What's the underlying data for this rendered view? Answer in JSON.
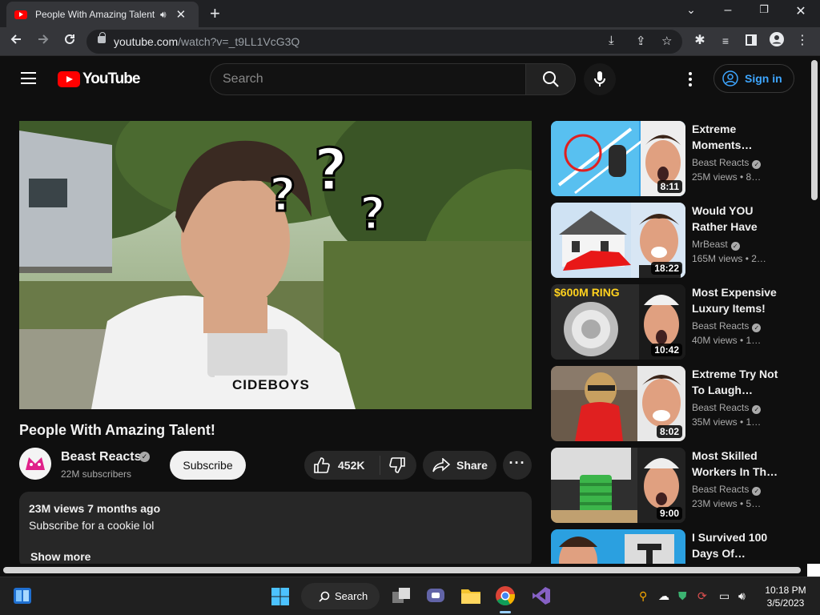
{
  "browser": {
    "tab_title": "People With Amazing Talent!",
    "new_tab_label": "+",
    "url_host": "youtube.com",
    "url_path": "/watch?v=_t9LL1VcG3Q",
    "window_controls": {
      "minimize": "–",
      "maximize": "❐",
      "close": "✕",
      "tab_search": "⌄"
    }
  },
  "masthead": {
    "logo_text": "YouTube",
    "search_placeholder": "Search",
    "sign_in_label": "Sign in"
  },
  "video": {
    "title": "People With Amazing Talent!",
    "channel_name": "Beast Reacts",
    "subscribers": "22M subscribers",
    "subscribe_label": "Subscribe",
    "likes": "452K",
    "share_label": "Share",
    "thumb_text": "CIDEBOYS"
  },
  "description": {
    "views_age": "23M views  7 months ago",
    "text": "Subscribe for a cookie lol",
    "show_more": "Show more"
  },
  "related": [
    {
      "title": "Extreme Moments…",
      "channel": "Beast Reacts",
      "verified": true,
      "views": "25M views  • 8…",
      "duration": "8:11"
    },
    {
      "title": "Would YOU Rather Have A…",
      "channel": "MrBeast",
      "verified": true,
      "views": "165M views  • 2…",
      "duration": "18:22"
    },
    {
      "title": "Most Expensive Luxury Items!",
      "channel": "Beast Reacts",
      "verified": true,
      "views": "40M views  • 1…",
      "duration": "10:42",
      "thumb_caption": "$600M RING"
    },
    {
      "title": "Extreme Try Not To Laugh…",
      "channel": "Beast Reacts",
      "verified": true,
      "views": "35M views  • 1…",
      "duration": "8:02"
    },
    {
      "title": "Most Skilled Workers In Th…",
      "channel": "Beast Reacts",
      "verified": true,
      "views": "23M views  • 5…",
      "duration": "9:00"
    },
    {
      "title": "I Survived 100 Days Of…",
      "channel": "",
      "verified": false,
      "views": "",
      "duration": ""
    }
  ],
  "taskbar": {
    "search_label": "Search",
    "time": "10:18 PM",
    "date": "3/5/2023"
  },
  "colors": {
    "accent": "#3ea6ff",
    "brand": "#ff0000",
    "background": "#0f0f0f"
  }
}
